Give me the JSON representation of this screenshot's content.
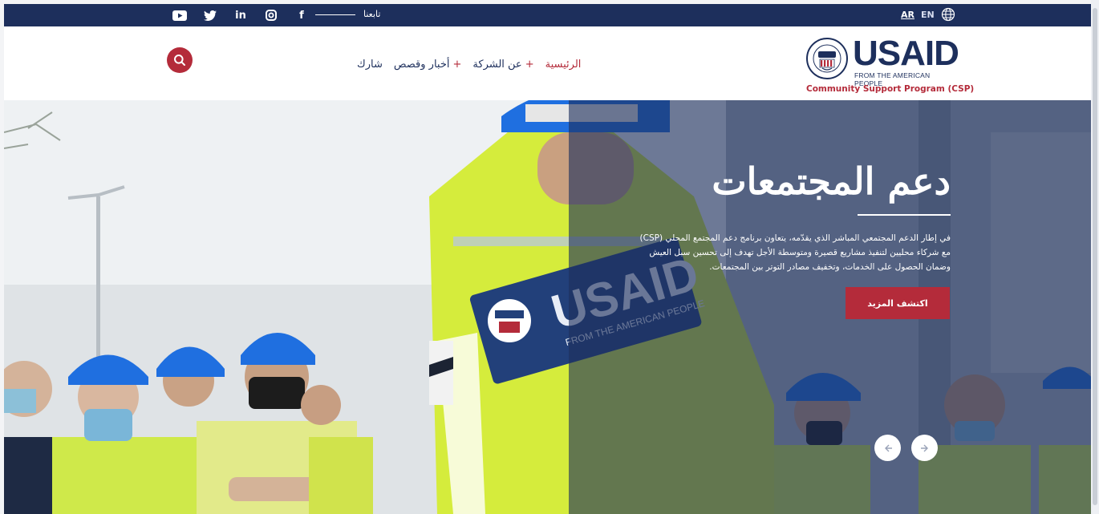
{
  "topbar": {
    "social": [
      {
        "icon": "youtube-icon",
        "glyph": "▶"
      },
      {
        "icon": "twitter-icon",
        "glyph": "🐦"
      },
      {
        "icon": "linkedin-icon",
        "glyph": "in"
      },
      {
        "icon": "instagram-icon",
        "glyph": "◎"
      },
      {
        "icon": "facebook-icon",
        "glyph": "f"
      }
    ],
    "follow_label": "تابعنا",
    "lang_ar": "AR",
    "lang_en": "EN"
  },
  "nav": {
    "items": [
      {
        "label": "الرئيسية",
        "plus": "",
        "active": true
      },
      {
        "label": "عن الشركة",
        "plus": "+",
        "active": false
      },
      {
        "label": "أخبار وقصص",
        "plus": "+",
        "active": false
      },
      {
        "label": "شارك",
        "plus": "",
        "active": false
      }
    ]
  },
  "logo": {
    "brand": "USAID",
    "tagline": "FROM THE AMERICAN PEOPLE",
    "program": "Community Support Program (CSP)"
  },
  "hero": {
    "title": "دعم المجتمعات",
    "text": "في إطار الدعم المجتمعي المباشر الذي يقدّمه، يتعاون برنامج دعم المجتمع المحلي (CSP) مع شركاء محليين لتنفيذ مشاريع قصيرة ومتوسطة الأجل تهدف إلى تحسين سبل العيش وضمان الحصول على الخدمات، وتخفيف مصادر التوتر بين المجتمعات.",
    "cta": "اكتشف المزيد",
    "vest_print": "USAID",
    "vest_print_sub": "FROM THE AMERICAN PEOPLE"
  },
  "colors": {
    "navy": "#1d2f5c",
    "red": "#b42b3a",
    "vest": "#d5ec3c"
  }
}
